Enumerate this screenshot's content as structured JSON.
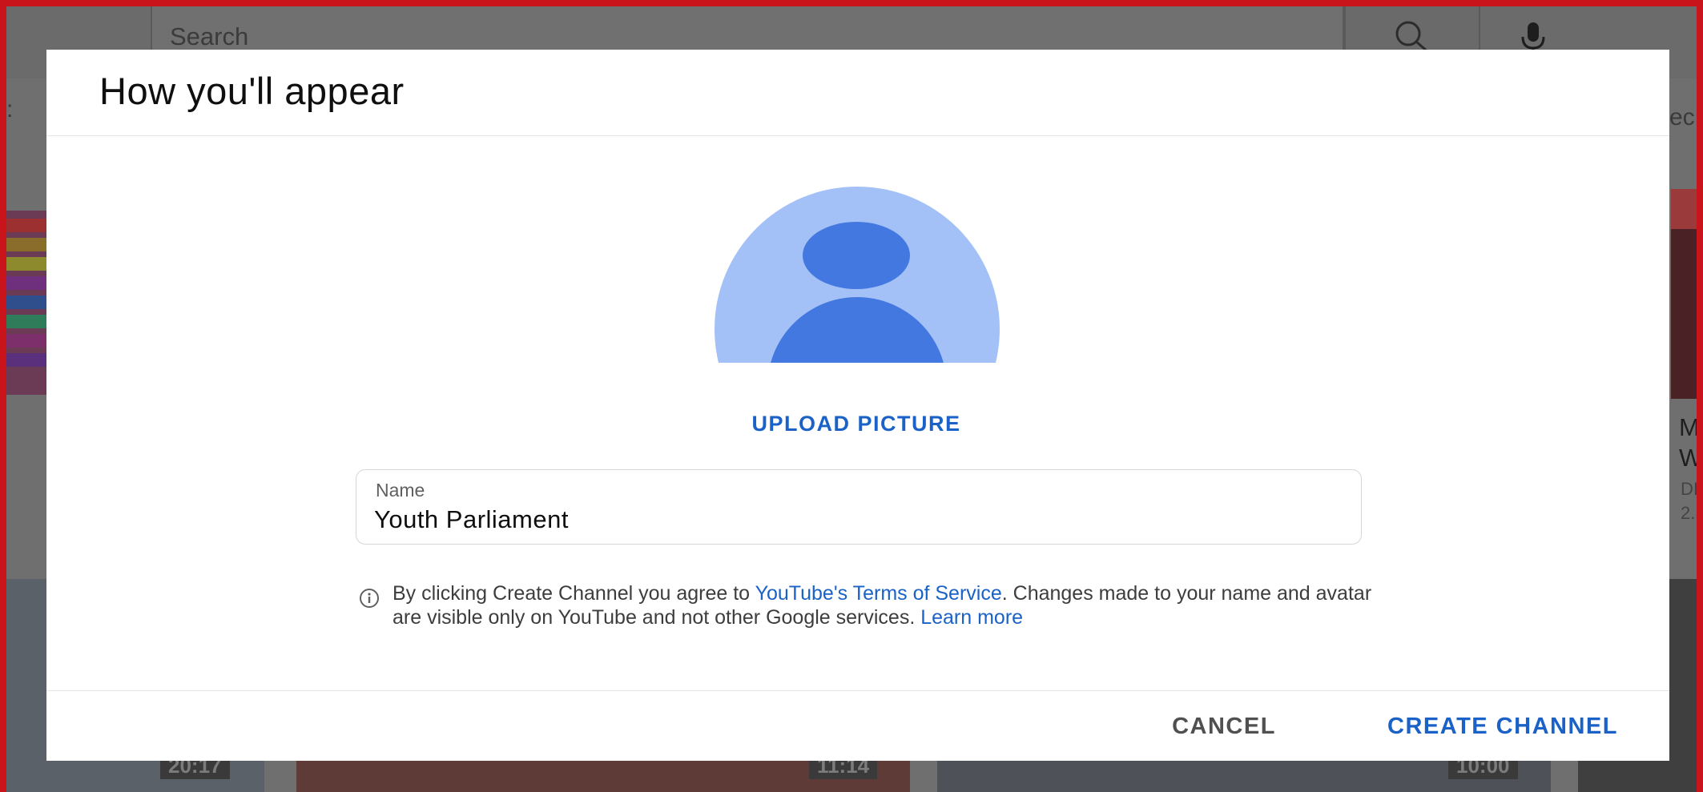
{
  "background": {
    "search_placeholder": "Search",
    "chip_left": ":",
    "chip_right": "ec",
    "right_video_title_line1": "M",
    "right_video_title_line2": "W",
    "right_video_meta_line1": "DI",
    "right_video_meta_line2": "2.",
    "durations": [
      "20:17",
      "11:14",
      "10:00"
    ]
  },
  "dialog": {
    "title": "How you'll appear",
    "upload_label": "UPLOAD PICTURE",
    "name_field": {
      "label": "Name",
      "value": "Youth Parliament"
    },
    "disclaimer": {
      "text_before": "By clicking Create Channel you agree to ",
      "terms_link": "YouTube's Terms of Service",
      "text_after": ". Changes made to your name and avatar are visible only on YouTube and not other Google services. ",
      "learn_more_link": "Learn more"
    },
    "cancel_label": "CANCEL",
    "create_label": "CREATE CHANNEL"
  },
  "colors": {
    "accent_blue": "#1a62c7",
    "avatar_light": "#a3c1f7",
    "avatar_dark": "#4378e0",
    "frame_red": "#c8141a"
  },
  "icons": {
    "search": "search-icon",
    "mic": "microphone-icon",
    "avatar": "default-avatar-icon",
    "info": "info-icon"
  }
}
